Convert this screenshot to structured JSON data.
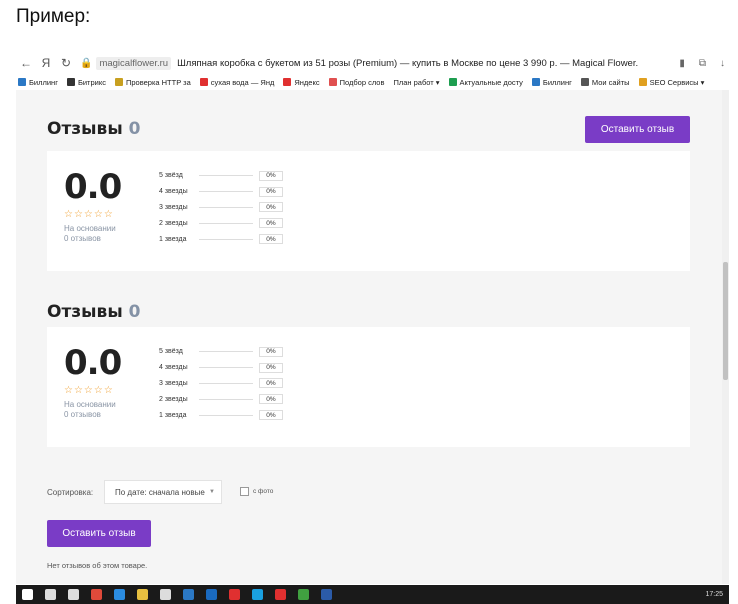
{
  "caption": "Пример:",
  "browser": {
    "back": "←",
    "yandex_logo": "Я",
    "reload": "↻",
    "host": "magicalflower.ru",
    "tab_title": "Шляпная коробка с букетом из 51 розы (Premium) — купить в Москве по цене 3 990 р. — Magical Flower.",
    "bookmarks": [
      {
        "label": "Биллинг",
        "color": "#2b78c5"
      },
      {
        "label": "Битрикс",
        "color": "#333333"
      },
      {
        "label": "Проверка HTTP за",
        "color": "#c8a020"
      },
      {
        "label": "сухая вода — Янд",
        "color": "#e03030"
      },
      {
        "label": "Яндекс",
        "color": "#e03030"
      },
      {
        "label": "Подбор слов",
        "color": "#e05050"
      },
      {
        "label": "План работ ▾",
        "color": ""
      },
      {
        "label": "Актуальные досту",
        "color": "#1e9e50"
      },
      {
        "label": "Биллинг",
        "color": "#2b78c5"
      },
      {
        "label": "Мои сайты",
        "color": "#555555"
      },
      {
        "label": "SEO Сервисы ▾",
        "color": "#e0a020"
      }
    ]
  },
  "reviews": [
    {
      "title": "Отзывы",
      "count": "0",
      "score": "0.0",
      "stars": "☆☆☆☆☆",
      "based_line1": "На основании",
      "based_line2": "0 отзывов",
      "distribution": [
        {
          "label": "5 звёзд",
          "percent": "0%",
          "fraction": 0
        },
        {
          "label": "4 звезды",
          "percent": "0%",
          "fraction": 0
        },
        {
          "label": "3 звезды",
          "percent": "0%",
          "fraction": 0
        },
        {
          "label": "2 звезды",
          "percent": "0%",
          "fraction": 0
        },
        {
          "label": "1 звезда",
          "percent": "0%",
          "fraction": 0
        }
      ]
    },
    {
      "title": "Отзывы",
      "count": "0",
      "score": "0.0",
      "stars": "☆☆☆☆☆",
      "based_line1": "На основании",
      "based_line2": "0 отзывов",
      "distribution": [
        {
          "label": "5 звёзд",
          "percent": "0%",
          "fraction": 0
        },
        {
          "label": "4 звезды",
          "percent": "0%",
          "fraction": 0
        },
        {
          "label": "3 звезды",
          "percent": "0%",
          "fraction": 0
        },
        {
          "label": "2 звезды",
          "percent": "0%",
          "fraction": 0
        },
        {
          "label": "1 звезда",
          "percent": "0%",
          "fraction": 0
        }
      ]
    }
  ],
  "leave_review_label": "Оставить отзыв",
  "sort": {
    "label": "Сортировка:",
    "selected": "По дате: сначала новые",
    "photo_label": "с фото",
    "photo_checked": false
  },
  "leave_review_bottom_label": "Оставить отзыв",
  "no_reviews_text": "Нет отзывов об этом товаре.",
  "colors": {
    "accent": "#7a3cc6",
    "star": "#f0a030"
  },
  "taskbar": {
    "icons": [
      {
        "name": "windows-start-icon",
        "color": "#ffffff"
      },
      {
        "name": "search-icon",
        "color": "#dddddd"
      },
      {
        "name": "task-view-icon",
        "color": "#dddddd"
      },
      {
        "name": "chrome-icon",
        "color": "#e04a3a"
      },
      {
        "name": "edge-icon",
        "color": "#2b8ce0"
      },
      {
        "name": "explorer-folder-icon",
        "color": "#e8c040"
      },
      {
        "name": "store-icon",
        "color": "#dddddd"
      },
      {
        "name": "mail-icon",
        "color": "#2b78c5"
      },
      {
        "name": "outlook-icon",
        "color": "#1a6ac0"
      },
      {
        "name": "yandex-browser-icon",
        "color": "#e03030"
      },
      {
        "name": "skype-icon",
        "color": "#1aa0e0"
      },
      {
        "name": "yandex-icon",
        "color": "#e03030"
      },
      {
        "name": "chrome-alt-icon",
        "color": "#40a040"
      },
      {
        "name": "word-icon",
        "color": "#2b5ba8"
      }
    ],
    "clock": "17:25"
  }
}
